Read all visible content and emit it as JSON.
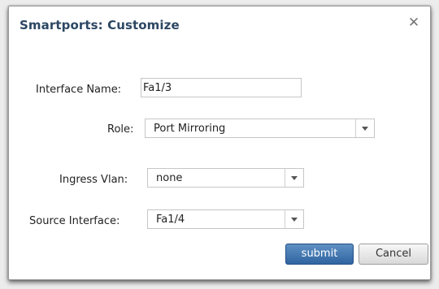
{
  "dialog": {
    "title": "Smartports: Customize",
    "close_glyph": "✕",
    "close_icon": "close-icon"
  },
  "form": {
    "interface_name": {
      "label": "Interface Name:",
      "value": "Fa1/3"
    },
    "role": {
      "label": "Role:",
      "selected": "Port Mirroring"
    },
    "ingress_vlan": {
      "label": "Ingress Vlan:",
      "selected": "none"
    },
    "source_interface": {
      "label": "Source Interface:",
      "selected": "Fa1/4"
    }
  },
  "buttons": {
    "submit_label": "submit",
    "cancel_label": "Cancel"
  },
  "colors": {
    "title": "#2c4763",
    "submit_bg": "#3a6ea8"
  }
}
